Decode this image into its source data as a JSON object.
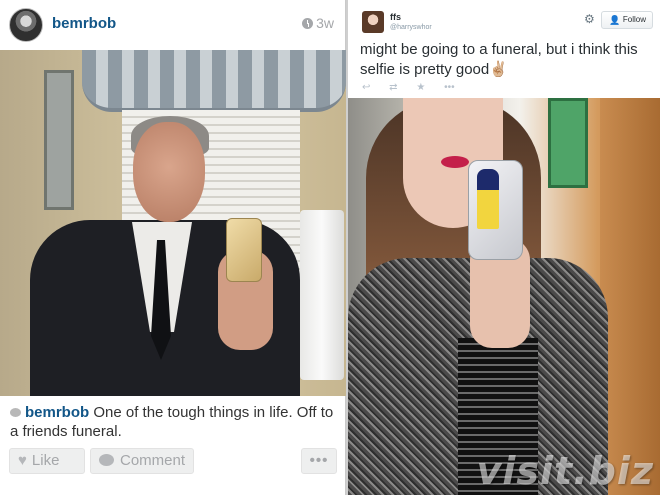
{
  "instagram": {
    "username": "bemrbob",
    "time_ago": "3w",
    "caption": {
      "username": "bemrbob",
      "text": "One of the tough things in life. Off to a friends funeral."
    },
    "actions": {
      "like_label": "Like",
      "comment_label": "Comment",
      "more_label": "•••"
    }
  },
  "tweet": {
    "display_name": "ffs",
    "handle": "@harryswhor",
    "follow_label": "Follow",
    "text": "might be going to a funeral, but i think this selfie is pretty good✌🏼",
    "actions": [
      "↩",
      "⇄",
      "★",
      "•••"
    ]
  },
  "watermark": "visit.biz",
  "colors": {
    "ig_link": "#125688",
    "muted_gray": "#a5a7aa",
    "tw_blue": "#55acee",
    "tw_text": "#292f33"
  }
}
